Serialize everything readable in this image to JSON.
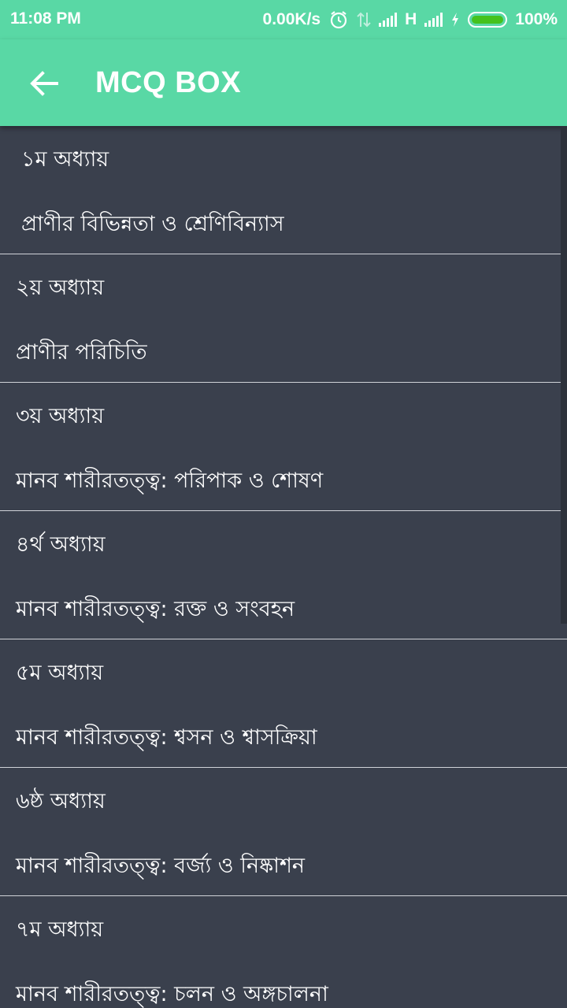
{
  "status_bar": {
    "time": "11:08 PM",
    "net_speed": "0.00K/s",
    "network_type": "H",
    "battery": "100%",
    "icons": [
      "alarm-icon",
      "data-transfer-icon",
      "signal-icon",
      "charging-icon",
      "battery-icon"
    ]
  },
  "app_bar": {
    "title": "MCQ BOX",
    "background": "#59d8a5",
    "back_icon": "arrow-left-icon"
  },
  "list": {
    "background": "#3a404d",
    "items": [
      {
        "chapter": "১ম অধ্যায়",
        "title": "প্রাণীর বিভিন্নতা ও শ্রেণিবিন্যাস"
      },
      {
        "chapter": "২য় অধ্যায়",
        "title": "প্রাণীর পরিচিতি"
      },
      {
        "chapter": "৩য় অধ্যায়",
        "title": "মানব শারীরতত্ত্ব: পরিপাক ও শোষণ"
      },
      {
        "chapter": "৪র্থ অধ্যায়",
        "title": "মানব শারীরতত্ত্ব: রক্ত ও সংবহন"
      },
      {
        "chapter": "৫ম অধ্যায়",
        "title": "মানব শারীরতত্ত্ব: শ্বসন ও শ্বাসক্রিয়া"
      },
      {
        "chapter": "৬ষ্ঠ অধ্যায়",
        "title": "মানব শারীরতত্ত্ব: বর্জ্য ও নিষ্কাশন"
      },
      {
        "chapter": "৭ম অধ্যায়",
        "title": "মানব শারীরতত্ত্ব: চলন ও অঙ্গচালনা"
      }
    ]
  }
}
